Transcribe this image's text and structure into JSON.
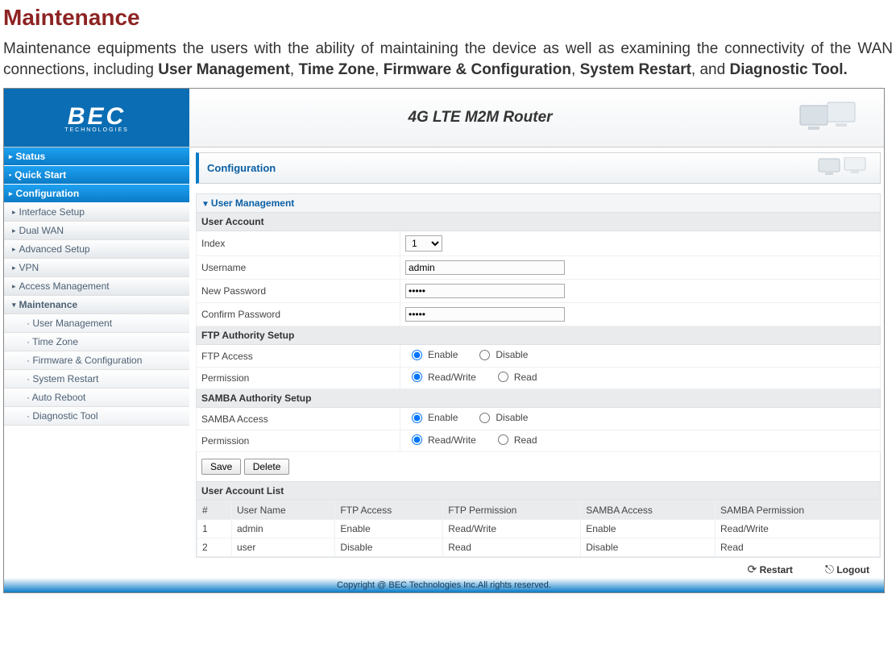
{
  "doc": {
    "title": "Maintenance",
    "intro_before": "Maintenance equipments the users with the ability of maintaining the device as well as examining the connectivity of the WAN connections, including ",
    "b1": "User Management",
    "c1": ", ",
    "b2": "Time Zone",
    "c2": ", ",
    "b3": "Firmware & Configuration",
    "c3": ", ",
    "b4": "System Restart",
    "c4": ", and ",
    "b5": "Diagnostic Tool."
  },
  "header": {
    "logo": "BEC",
    "logo_sub": "TECHNOLOGIES",
    "product": "4G LTE M2M Router"
  },
  "sidebar": {
    "top": [
      "Status",
      "Quick Start",
      "Configuration"
    ],
    "conf": [
      "Interface Setup",
      "Dual WAN",
      "Advanced Setup",
      "VPN",
      "Access Management",
      "Maintenance"
    ],
    "maint": [
      "User Management",
      "Time Zone",
      "Firmware & Configuration",
      "System Restart",
      "Auto Reboot",
      "Diagnostic Tool"
    ]
  },
  "panel": {
    "title": "Configuration",
    "section": "User Management",
    "user_account": "User Account",
    "labels": {
      "index": "Index",
      "username": "Username",
      "newpw": "New Password",
      "confpw": "Confirm Password"
    },
    "values": {
      "index": "1",
      "username": "admin",
      "newpw": "•••••",
      "confpw": "•••••"
    },
    "ftp_setup": "FTP Authority Setup",
    "ftp_access_label": "FTP Access",
    "permission_label": "Permission",
    "radio": {
      "enable": "Enable",
      "disable": "Disable",
      "readwrite": "Read/Write",
      "read": "Read"
    },
    "samba_setup": "SAMBA Authority Setup",
    "samba_access_label": "SAMBA Access",
    "buttons": {
      "save": "Save",
      "delete": "Delete"
    },
    "list_title": "User Account List",
    "list_headers": [
      "#",
      "User Name",
      "FTP Access",
      "FTP Permission",
      "SAMBA Access",
      "SAMBA Permission"
    ],
    "list_rows": [
      [
        "1",
        "admin",
        "Enable",
        "Read/Write",
        "Enable",
        "Read/Write"
      ],
      [
        "2",
        "user",
        "Disable",
        "Read",
        "Disable",
        "Read"
      ]
    ]
  },
  "footer": {
    "restart": "Restart",
    "logout": "Logout",
    "copyright": "Copyright @ BEC Technologies Inc.All rights reserved."
  }
}
